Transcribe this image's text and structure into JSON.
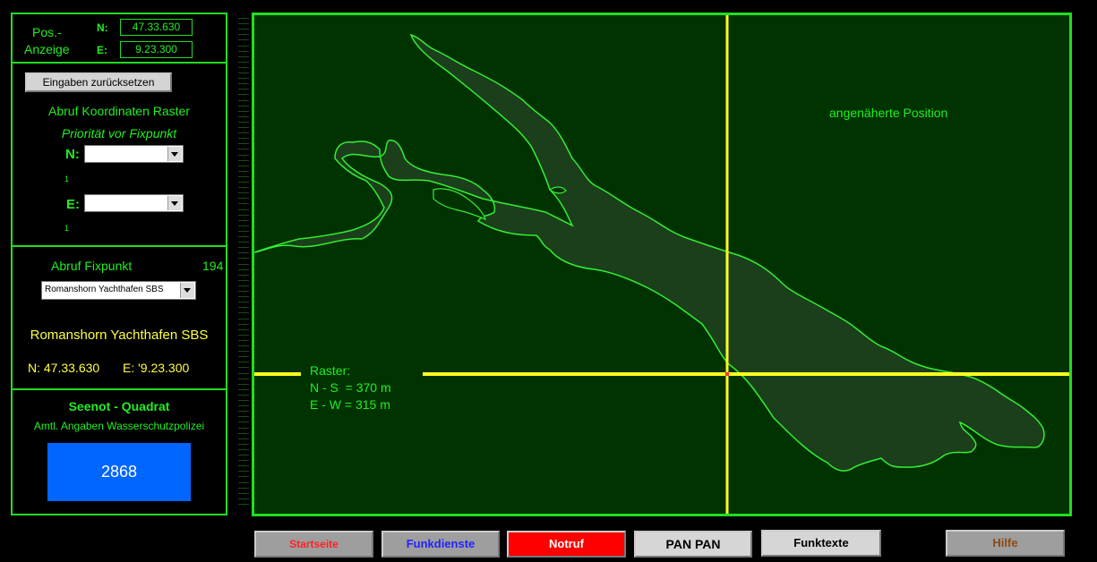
{
  "pos": {
    "label_line1": "Pos.-",
    "label_line2": "Anzeige",
    "n_label": "N:",
    "n_value": "47.33.630",
    "e_label": "E:",
    "e_value": "9.23.300"
  },
  "grid": {
    "reset_button": "Eingaben zurücksetzen",
    "title": "Abruf Koordinaten Raster",
    "subtitle": "Priorität vor Fixpunkt",
    "n_label": "N:",
    "n_value": "",
    "n_count": "1",
    "e_label": "E:",
    "e_value": "",
    "e_count": "1"
  },
  "fix": {
    "title": "Abruf Fixpunkt",
    "count": "194",
    "selected": "Romanshorn Yachthafen SBS",
    "name": "Romanshorn Yachthafen SBS",
    "n_text": "N: 47.33.630",
    "e_text": "E: '9.23.300"
  },
  "seenot": {
    "title": "Seenot - Quadrat",
    "subtitle": "Amtl. Angaben Wasserschutzpolizei",
    "value": "2868",
    "color": "#0066ff"
  },
  "map": {
    "approx_label": "angenäherte Position",
    "raster_title": "Raster:",
    "raster_ns": "N - S  = 370 m",
    "raster_ew": "E - W = 315 m",
    "crosshair_color": "#ffff22",
    "background_color": "#003300",
    "lake_color": "#1b3f1b"
  },
  "nav": {
    "start": "Startseite",
    "funkdienste": "Funkdienste",
    "notruf": "Notruf",
    "panpan": "PAN PAN",
    "funktexte": "Funktexte",
    "hilfe": "Hilfe"
  },
  "colors": {
    "accent": "#22dd22",
    "label_yellow": "#ffff44",
    "notruf_bg": "#ff0000"
  }
}
